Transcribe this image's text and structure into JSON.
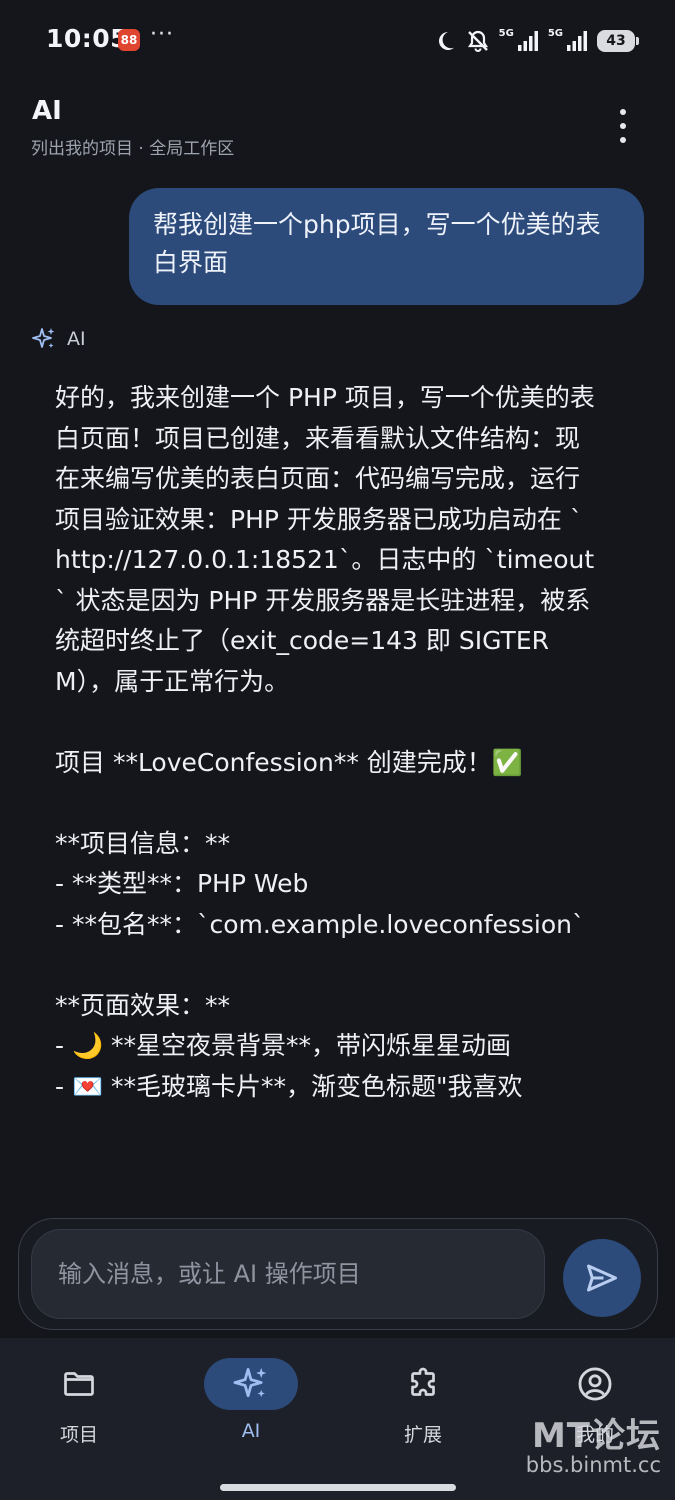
{
  "status_bar": {
    "time": "10:05",
    "app_badge": "88",
    "more": "···",
    "net1": "5G",
    "net2": "5G",
    "battery": "43",
    "icons": [
      "moon-icon",
      "mute-vibrate-icon",
      "signal-icon",
      "signal-icon",
      "battery-icon"
    ]
  },
  "app_bar": {
    "title": "AI",
    "subtitle": "列出我的项目 · 全局工作区",
    "menu_icon": "more-vertical-icon"
  },
  "chat": {
    "user_message": "帮我创建一个php项目，写一个优美的表白界面",
    "ai_label": "AI",
    "ai_icon": "sparkles-icon",
    "ai_message": "好的，我来创建一个 PHP 项目，写一个优美的表白页面！项目已创建，来看看默认文件结构：现在来编写优美的表白页面：代码编写完成，运行项目验证效果：PHP 开发服务器已成功启动在 `http://127.0.0.1:18521`。日志中的 `timeout` 状态是因为 PHP 开发服务器是长驻进程，被系统超时终止了（exit_code=143 即 SIGTERM），属于正常行为。\n\n项目 **LoveConfession** 创建完成！✅\n\n**项目信息：**\n- **类型**：PHP Web\n- **包名**：`com.example.loveconfession`\n\n**页面效果：**\n- 🌙 **星空夜景背景**，带闪烁星星动画\n- 💌 **毛玻璃卡片**，渐变色标题\"我喜欢"
  },
  "input": {
    "placeholder": "输入消息，或让 AI 操作项目",
    "value": "",
    "send_icon": "send-icon"
  },
  "bottom_nav": {
    "items": [
      {
        "label": "项目",
        "icon": "folder-icon",
        "active": false
      },
      {
        "label": "AI",
        "icon": "sparkles-icon",
        "active": true
      },
      {
        "label": "扩展",
        "icon": "puzzle-icon",
        "active": false
      },
      {
        "label": "我的",
        "icon": "account-icon",
        "active": false
      }
    ]
  },
  "watermark": {
    "line1": "MT论坛",
    "line2": "bbs.binmt.cc"
  },
  "colors": {
    "background": "#14161c",
    "accent": "#2c4a7a",
    "accent_text": "#9ebdf0",
    "nav_background": "#1d2028"
  }
}
